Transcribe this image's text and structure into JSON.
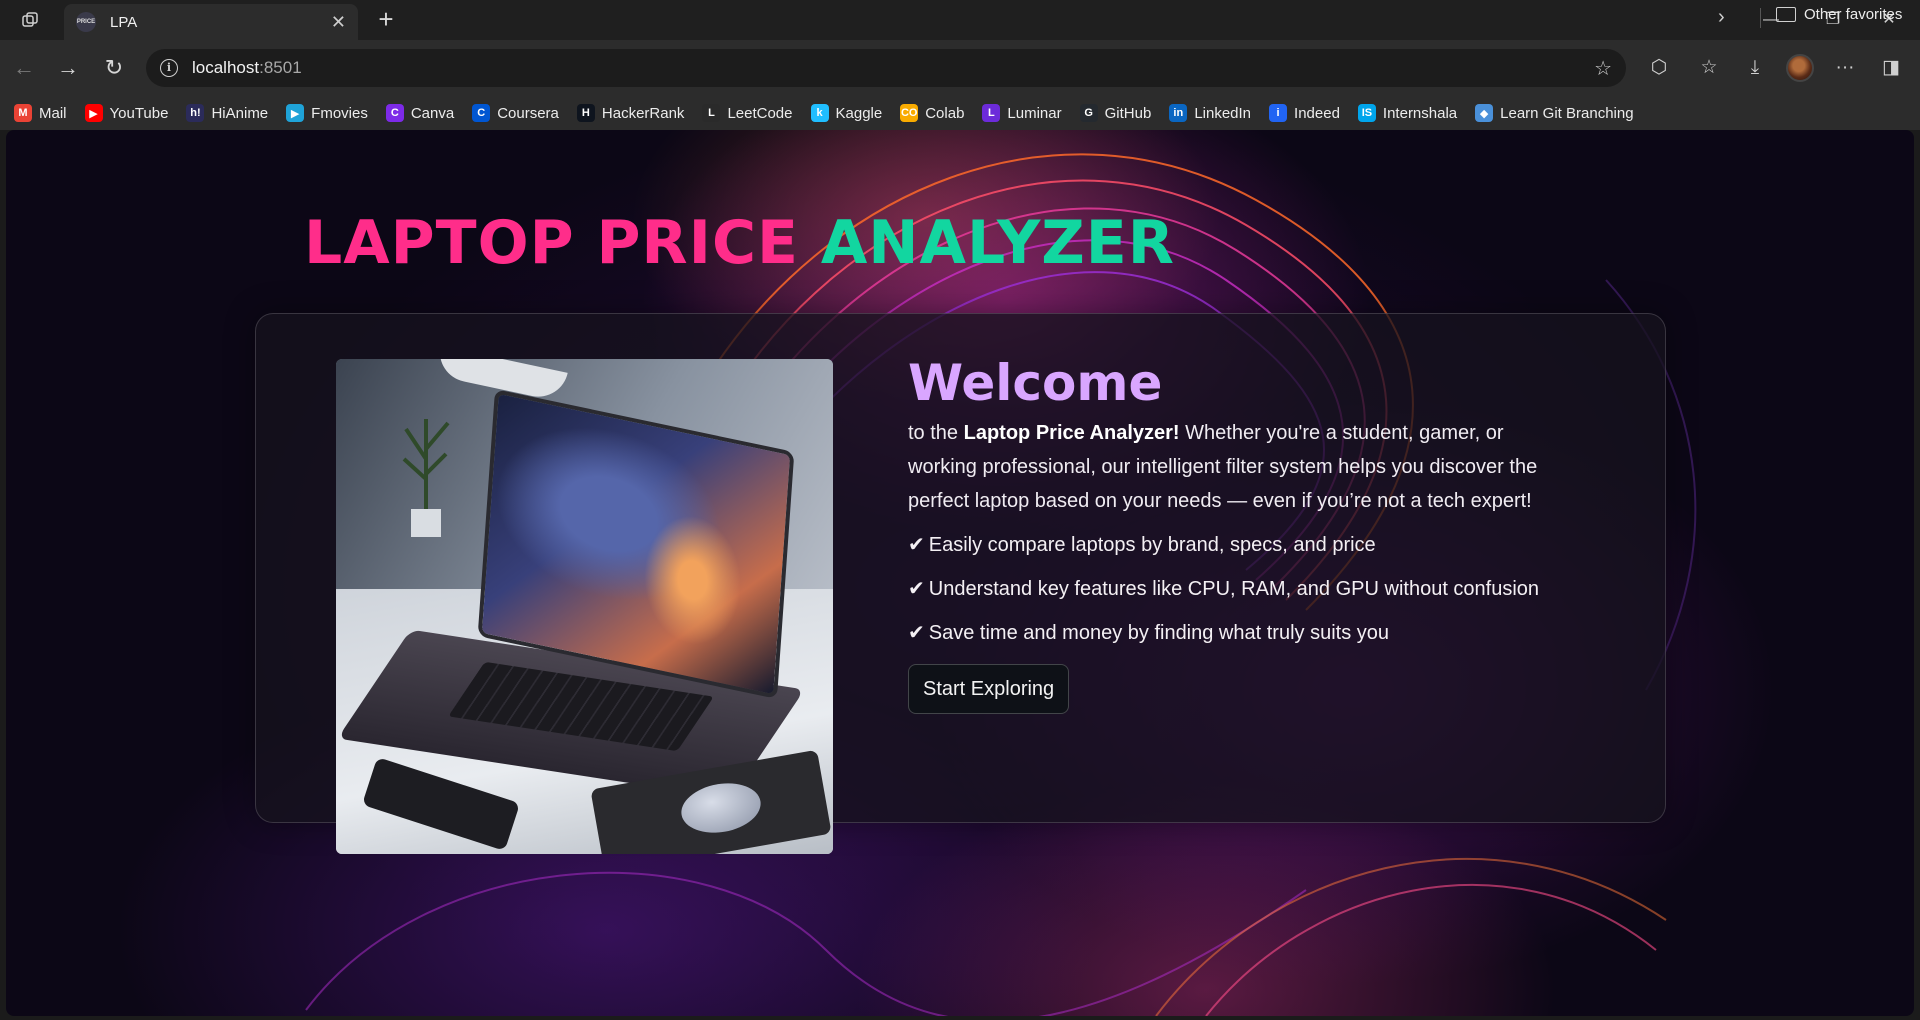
{
  "browser": {
    "tab": {
      "favicon_text": "PRICE",
      "title": "LPA"
    },
    "url": {
      "host": "localhost",
      "port": ":8501"
    },
    "favorites": [
      {
        "label": "Mail",
        "icon": "gmail-icon",
        "color": "#ea4335",
        "glyph": "M"
      },
      {
        "label": "YouTube",
        "icon": "youtube-icon",
        "color": "#ff0000",
        "glyph": "▶"
      },
      {
        "label": "HiAnime",
        "icon": "hianime-icon",
        "color": "#2b2b5a",
        "glyph": "h!"
      },
      {
        "label": "Fmovies",
        "icon": "fmovies-icon",
        "color": "#1fa3d8",
        "glyph": "▶"
      },
      {
        "label": "Canva",
        "icon": "canva-icon",
        "color": "#7d2ae8",
        "glyph": "C"
      },
      {
        "label": "Coursera",
        "icon": "coursera-icon",
        "color": "#0056d2",
        "glyph": "C"
      },
      {
        "label": "HackerRank",
        "icon": "hackerrank-icon",
        "color": "#0e141e",
        "glyph": "H"
      },
      {
        "label": "LeetCode",
        "icon": "leetcode-icon",
        "color": "#2a2a2a",
        "glyph": "L"
      },
      {
        "label": "Kaggle",
        "icon": "kaggle-icon",
        "color": "#20beff",
        "glyph": "k"
      },
      {
        "label": "Colab",
        "icon": "colab-icon",
        "color": "#f9ab00",
        "glyph": "CO"
      },
      {
        "label": "Luminar",
        "icon": "luminar-icon",
        "color": "#6c2bd9",
        "glyph": "L"
      },
      {
        "label": "GitHub",
        "icon": "github-icon",
        "color": "#24292f",
        "glyph": "G"
      },
      {
        "label": "LinkedIn",
        "icon": "linkedin-icon",
        "color": "#0a66c2",
        "glyph": "in"
      },
      {
        "label": "Indeed",
        "icon": "indeed-icon",
        "color": "#2164f3",
        "glyph": "i"
      },
      {
        "label": "Internshala",
        "icon": "internshala-icon",
        "color": "#00a5ec",
        "glyph": "IS"
      },
      {
        "label": "Learn Git Branching",
        "icon": "learn-git-icon",
        "color": "#4a90d9",
        "glyph": "◆"
      }
    ],
    "other_favorites": "Other favorites"
  },
  "page": {
    "title_part1": "LAPTOP PRICE",
    "title_part2": "ANALYZER",
    "welcome_heading": "Welcome",
    "intro_prefix": "to the ",
    "intro_bold": "Laptop Price Analyzer!",
    "intro_rest": " Whether you're a student, gamer, or working professional, our intelligent filter system helps you discover the perfect laptop based on your needs — even if you’re not a tech expert!",
    "check_mark": "✔",
    "bullets": [
      "Easily compare laptops by brand, specs, and price",
      "Understand key features like CPU, RAM, and GPU without confusion",
      "Save time and money by finding what truly suits you"
    ],
    "cta_label": "Start Exploring",
    "colors": {
      "title_pink": "#ff2d8a",
      "title_green": "#12d6a0",
      "welcome_purple": "#d9a6ff"
    }
  }
}
